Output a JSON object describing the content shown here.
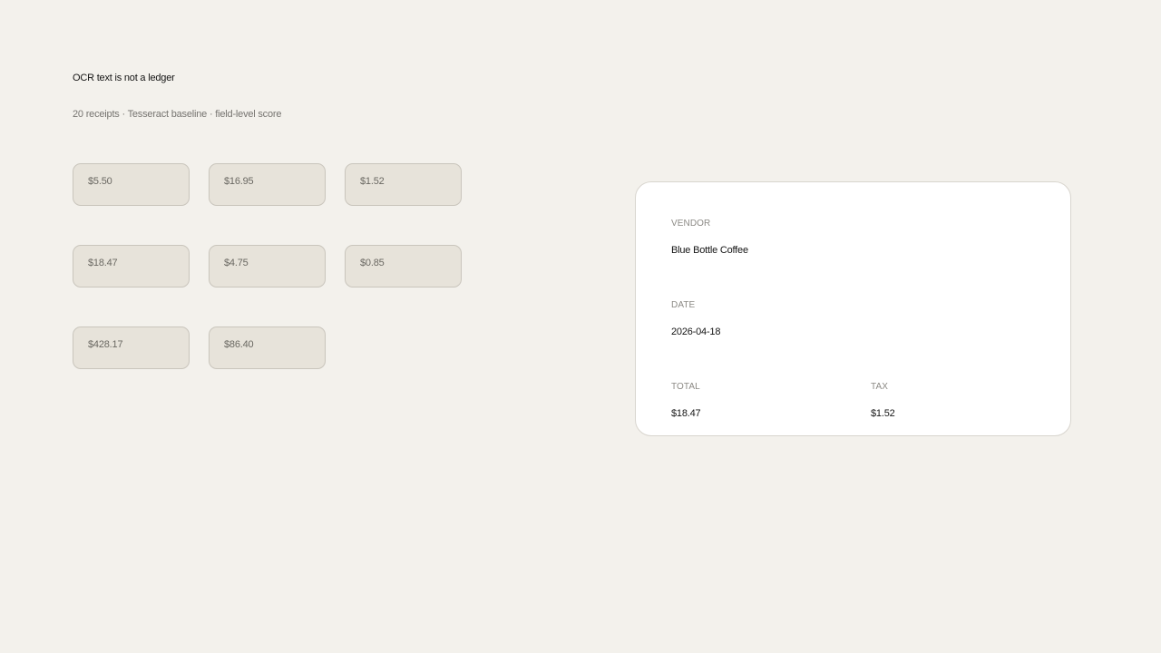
{
  "header": {
    "title": "OCR text is not a ledger",
    "subtitle": "20 receipts · Tesseract baseline · field-level score"
  },
  "amount_chips": [
    {
      "label": "$5.50"
    },
    {
      "label": "$16.95"
    },
    {
      "label": "$1.52"
    },
    {
      "label": "$18.47"
    },
    {
      "label": "$4.75"
    },
    {
      "label": "$0.85"
    },
    {
      "label": "$428.17"
    },
    {
      "label": "$86.40"
    }
  ],
  "receipt_card": {
    "vendor": {
      "label": "VENDOR",
      "value": "Blue Bottle Coffee"
    },
    "date": {
      "label": "DATE",
      "value": "2026-04-18"
    },
    "total": {
      "label": "TOTAL",
      "value": "$18.47"
    },
    "tax": {
      "label": "TAX",
      "value": "$1.52"
    }
  },
  "colors": {
    "background": "#f3f1ec",
    "chip_fill": "#e7e3da",
    "chip_border": "#c9c5bc",
    "card_fill": "#ffffff",
    "text_primary": "#141414",
    "text_muted": "#8c8a85"
  }
}
